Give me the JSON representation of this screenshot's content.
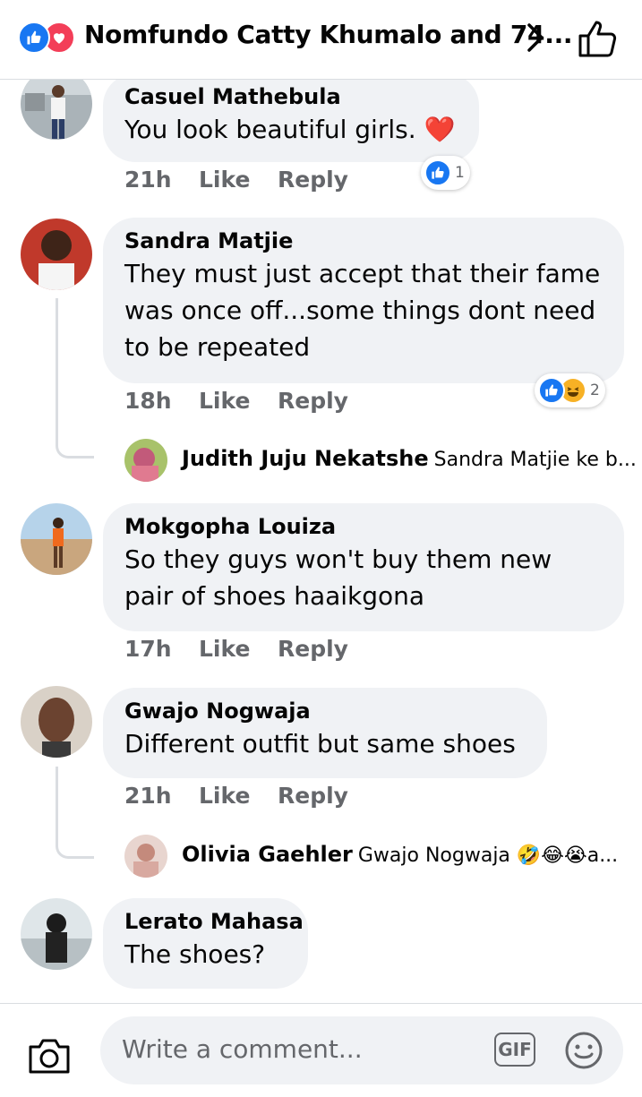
{
  "header": {
    "title": "Nomfundo Catty Khumalo and 74...",
    "reaction_icons": [
      "like-icon",
      "love-icon"
    ]
  },
  "comments": [
    {
      "author": "Casuel Mathebula",
      "text": "You look beautiful girls. ❤️",
      "time": "21h",
      "like_label": "Like",
      "reply_label": "Reply",
      "reaction_count": "1"
    },
    {
      "author": "Sandra Matjie",
      "text": "They must just accept that their fame was once off...some things dont need to be repeated",
      "time": "18h",
      "like_label": "Like",
      "reply_label": "Reply",
      "reaction_count": "2",
      "reply": {
        "author": "Judith Juju Nekatshe",
        "text": "Sandra Matjie ke b..."
      }
    },
    {
      "author": "Mokgopha Louiza",
      "text": "So they guys won't buy them new pair of shoes haaikgona",
      "time": "17h",
      "like_label": "Like",
      "reply_label": "Reply"
    },
    {
      "author": "Gwajo Nogwaja",
      "text": "Different outfit but same shoes",
      "time": "21h",
      "like_label": "Like",
      "reply_label": "Reply",
      "reply": {
        "author": "Olivia Gaehler",
        "text": "Gwajo Nogwaja 🤣😂😭a..."
      }
    },
    {
      "author": "Lerato Mahasa",
      "text": "The shoes?"
    }
  ],
  "composer": {
    "placeholder": "Write a comment...",
    "gif_label": "GIF"
  },
  "colors": {
    "like_blue": "#1877f2",
    "love_red": "#f33e58",
    "bubble_gray": "#f0f2f5",
    "meta_gray": "#65676b"
  }
}
